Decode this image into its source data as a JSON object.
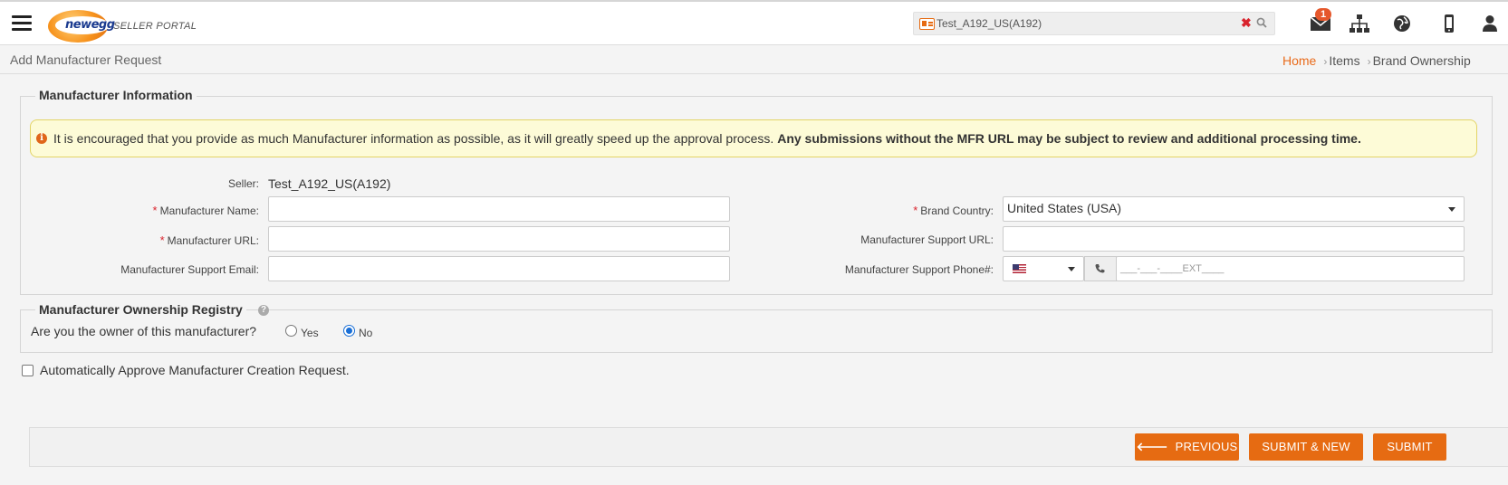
{
  "header": {
    "brand": "newegg",
    "portal_name": "SELLER PORTAL",
    "search_value": "Test_A192_US(A192)",
    "mail_count": "1"
  },
  "page": {
    "title": "Add Manufacturer Request",
    "breadcrumb": [
      "Home",
      "Items",
      "Brand Ownership"
    ]
  },
  "manufacturer_info": {
    "legend": "Manufacturer Information",
    "alert_text": "It is encouraged that you provide as much Manufacturer information as possible, as it will greatly speed up the approval process.",
    "alert_bold": "Any submissions without the MFR URL may be subject to review and additional processing time.",
    "seller_label": "Seller:",
    "seller_value": "Test_A192_US(A192)",
    "name_label": "Manufacturer Name:",
    "url_label": "Manufacturer URL:",
    "email_label": "Manufacturer Support Email:",
    "country_label": "Brand Country:",
    "country_value": "United States (USA)",
    "support_url_label": "Manufacturer Support URL:",
    "phone_label": "Manufacturer Support Phone#:",
    "phone_placeholder": "___-___-____EXT____"
  },
  "registry": {
    "legend": "Manufacturer Ownership Registry",
    "question": "Are you the owner of this manufacturer?",
    "yes_label": "Yes",
    "no_label": "No",
    "selected": "No"
  },
  "auto_approve_label": "Automatically Approve Manufacturer Creation Request.",
  "actions": {
    "previous": "PREVIOUS",
    "submit_new": "SUBMIT & NEW",
    "submit": "SUBMIT"
  },
  "colors": {
    "accent": "#e66b12",
    "alert_bg": "#fdfbd7",
    "required": "#d9232d"
  }
}
